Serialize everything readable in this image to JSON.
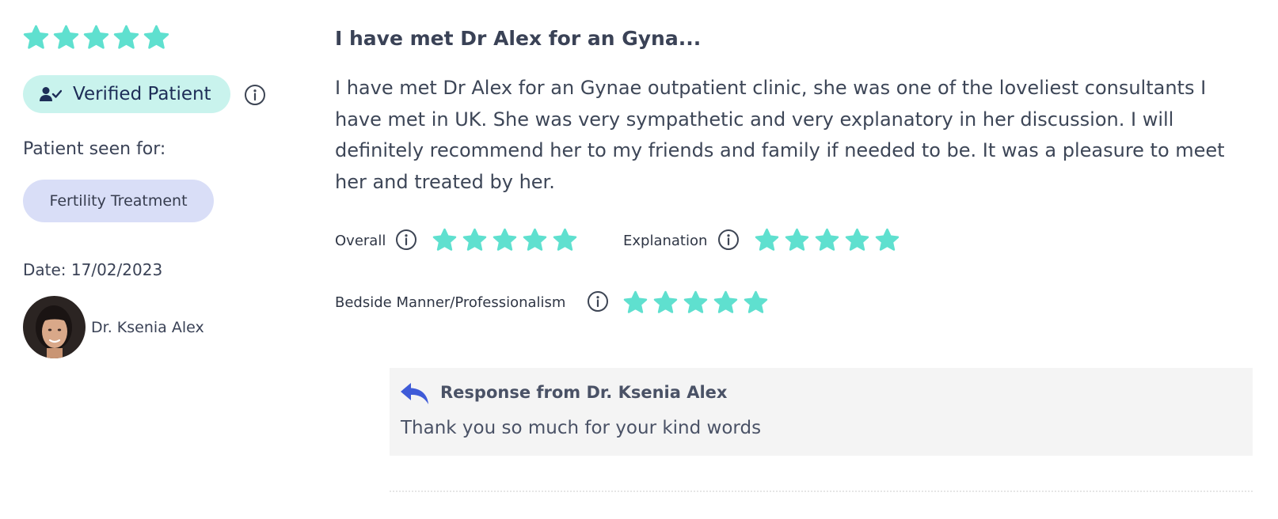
{
  "review": {
    "rating": 5,
    "max_rating": 5,
    "verified_label": "Verified Patient",
    "seen_for_label": "Patient seen for:",
    "treatment": "Fertility Treatment",
    "date": "Date: 17/02/2023",
    "doctor_name": "Dr. Ksenia Alex",
    "title": "I have met Dr Alex for an Gyna...",
    "body": "I have met Dr Alex for an Gynae outpatient clinic, she was one of the loveliest consultants I have met in UK. She was very sympathetic and very explanatory in her discussion. I will definitely recommend her to my friends and family if needed to be. It was a pleasure to meet her and treated by her."
  },
  "ratings": [
    {
      "label": "Overall",
      "value": 5
    },
    {
      "label": "Explanation",
      "value": 5
    },
    {
      "label": "Bedside Manner/Professionalism",
      "value": 5
    }
  ],
  "response": {
    "title": "Response from Dr. Ksenia Alex",
    "text": "Thank you so much for your kind words"
  },
  "colors": {
    "star": "#5fe0cf",
    "verified_bg": "#c9f3ed",
    "pill_bg": "#d9def7",
    "reply_icon": "#3f5bd8",
    "response_bg": "#f4f4f4"
  },
  "icons": {
    "star": "star-icon",
    "verified": "user-check-icon",
    "info": "info-icon",
    "reply": "reply-arrow-icon"
  }
}
